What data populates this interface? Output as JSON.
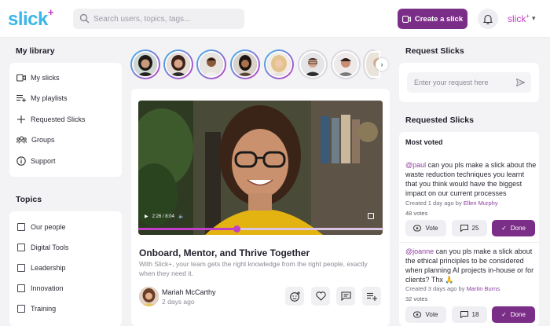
{
  "header": {
    "logo_text": "slick",
    "logo_plus": "+",
    "search_placeholder": "Search users, topics, tags...",
    "create_label": "Create a slick",
    "account_label": "slick",
    "account_sup": "+"
  },
  "library": {
    "title": "My library",
    "items": [
      {
        "label": "My slicks",
        "icon": "video-icon"
      },
      {
        "label": "My playlists",
        "icon": "playlist-icon"
      },
      {
        "label": "Requested Slicks",
        "icon": "plus-icon"
      },
      {
        "label": "Groups",
        "icon": "groups-icon"
      },
      {
        "label": "Support",
        "icon": "info-icon"
      }
    ]
  },
  "topics": {
    "title": "Topics",
    "items": [
      "Our people",
      "Digital Tools",
      "Leadership",
      "Innovation",
      "Training"
    ]
  },
  "post": {
    "video_time": "2:26 / 8:04",
    "title": "Onboard, Mentor, and Thrive Together",
    "description": "With Slick+, your team gets the right knowledge from the right people, exactly when they need it.",
    "author": "Mariah McCarthy",
    "time": "2 days ago",
    "progress": 0.4
  },
  "request": {
    "title": "Request Slicks",
    "placeholder": "Enter your request here"
  },
  "requested": {
    "title": "Requested Slicks",
    "sort_label": "Most voted",
    "items": [
      {
        "mention": "@paul",
        "text": " can you pls make a slick about the waste reduction techniques you learnt that you think would have the biggest impact on our current processes",
        "created": "Created 1 day ago by ",
        "by": "Ellen Murphy",
        "votes": "48 votes",
        "vote_label": "Vote",
        "comments": "25",
        "done_label": "Done"
      },
      {
        "mention": "@joanne",
        "text": " can you pls make a slick about the ethical principles to be considered when planning AI projects in-house or for clients? Thx 🙏",
        "created": "Created 3 days ago by ",
        "by": "Martin Burns",
        "votes": "32 votes",
        "vote_label": "Vote",
        "comments": "18",
        "done_label": "Done"
      }
    ]
  },
  "colors": {
    "brand_purple": "#7b2e87",
    "logo_blue": "#3bb6e8",
    "accent_magenta": "#c03fc4"
  }
}
